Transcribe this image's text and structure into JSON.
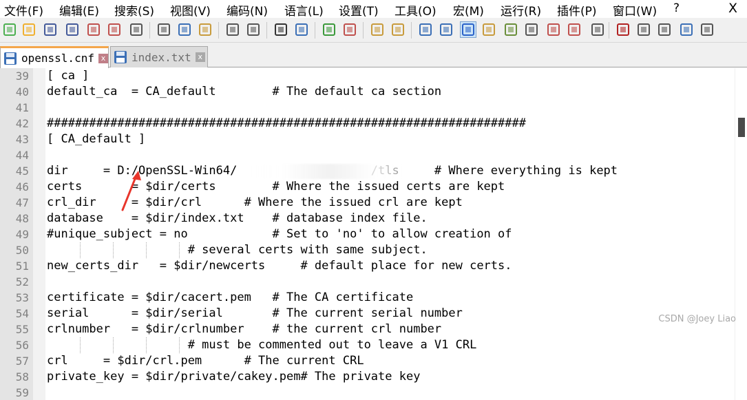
{
  "menu": {
    "items": [
      "文件(F)",
      "编辑(E)",
      "搜索(S)",
      "视图(V)",
      "编码(N)",
      "语言(L)",
      "设置(T)",
      "工具(O)",
      "宏(M)",
      "运行(R)",
      "插件(P)",
      "窗口(W)",
      "?"
    ],
    "close_label": "X"
  },
  "toolbar": {
    "buttons": [
      "new-file-icon",
      "open-file-icon",
      "save-icon",
      "save-all-icon",
      "close-icon",
      "close-all-icon",
      "print-icon",
      "cut-icon",
      "copy-icon",
      "paste-icon",
      "undo-icon",
      "redo-icon",
      "find-icon",
      "replace-icon",
      "zoom-in-icon",
      "zoom-out-icon",
      "sync-vertical-icon",
      "sync-horizontal-icon",
      "word-wrap-icon",
      "show-all-chars-icon",
      "indent-guide-icon",
      "user-language-icon",
      "doc-map-icon",
      "function-list-icon",
      "folder-workspace-icon",
      "doc-list-icon",
      "monitor-icon",
      "record-macro-icon",
      "stop-macro-icon",
      "play-macro-icon",
      "run-macro-multiple-icon",
      "save-macro-icon"
    ],
    "active_button": "indent-guide-icon"
  },
  "tabs": [
    {
      "label": "openssl.cnf",
      "active": true,
      "close": "x"
    },
    {
      "label": "index.txt",
      "active": false,
      "close": "x"
    }
  ],
  "editor": {
    "lines": [
      {
        "num": "39",
        "text": "[ ca ]"
      },
      {
        "num": "40",
        "text": "default_ca  = CA_default        # The default ca section"
      },
      {
        "num": "41",
        "text": ""
      },
      {
        "num": "42",
        "text": "####################################################################"
      },
      {
        "num": "43",
        "text": "[ CA_default ]"
      },
      {
        "num": "44",
        "text": ""
      },
      {
        "num": "45",
        "text": "dir     = D:/OpenSSL-Win64/                   /tls     # Where everything is kept"
      },
      {
        "num": "46",
        "text": "certs       = $dir/certs        # Where the issued certs are kept"
      },
      {
        "num": "47",
        "text": "crl_dir     = $dir/crl      # Where the issued crl are kept"
      },
      {
        "num": "48",
        "text": "database    = $dir/index.txt    # database index file."
      },
      {
        "num": "49",
        "text": "#unique_subject = no            # Set to 'no' to allow creation of"
      },
      {
        "num": "50",
        "text": "                    # several certs with same subject."
      },
      {
        "num": "51",
        "text": "new_certs_dir   = $dir/newcerts     # default place for new certs."
      },
      {
        "num": "52",
        "text": ""
      },
      {
        "num": "53",
        "text": "certificate = $dir/cacert.pem   # The CA certificate"
      },
      {
        "num": "54",
        "text": "serial      = $dir/serial       # The current serial number"
      },
      {
        "num": "55",
        "text": "crlnumber   = $dir/crlnumber    # the current crl number"
      },
      {
        "num": "56",
        "text": "                    # must be commented out to leave a V1 CRL"
      },
      {
        "num": "57",
        "text": "crl     = $dir/crl.pem      # The current CRL"
      },
      {
        "num": "58",
        "text": "private_key = $dir/private/cakey.pem# The private key"
      },
      {
        "num": "59",
        "text": ""
      }
    ]
  },
  "watermark": "CSDN @Joey Liao"
}
